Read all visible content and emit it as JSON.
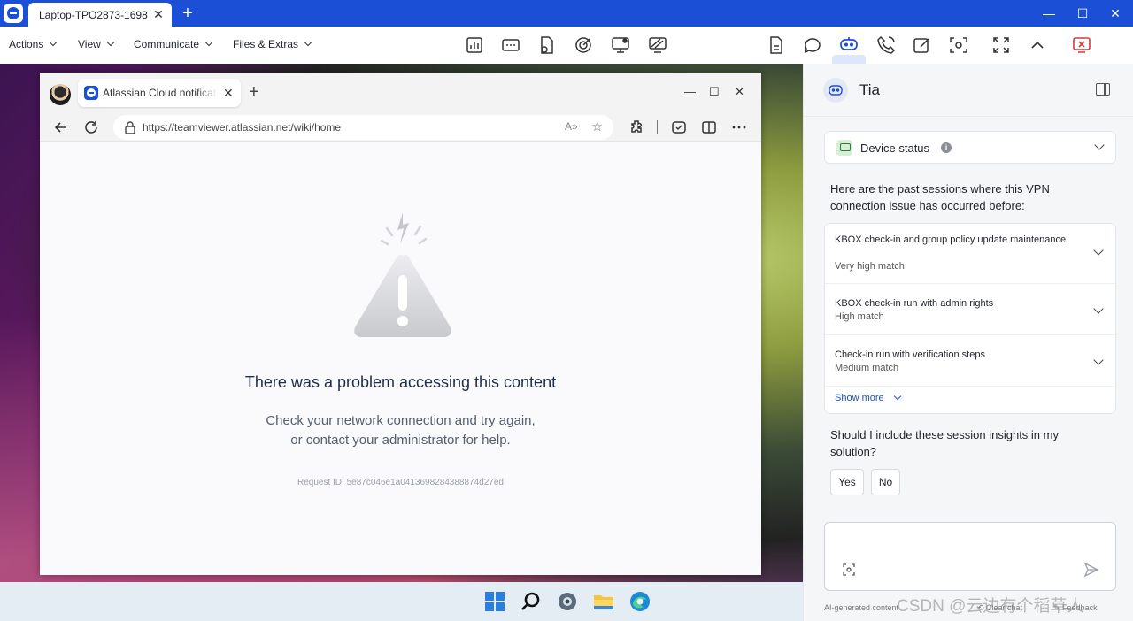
{
  "teamviewer": {
    "tab_title": "Laptop-TPO2873-1698",
    "tab_close": "✕",
    "new_tab": "+",
    "window_controls": {
      "minimize": "—",
      "maximize": "☐",
      "close": "✕"
    },
    "menus": [
      "Actions",
      "View",
      "Communicate",
      "Files & Extras"
    ],
    "toolbar_icons": [
      "dashboard-icon",
      "remote-input-icon",
      "file-transfer-icon",
      "target-icon",
      "screen-record-icon",
      "disable-wallpaper-icon",
      "document-icon",
      "chat-icon",
      "tia-assistant-icon",
      "call-icon",
      "notes-icon",
      "screenshot-icon",
      "fullscreen-icon",
      "collapse-icon",
      "end-session-icon"
    ]
  },
  "browser": {
    "tab_label": "Atlassian Cloud notificat",
    "tab_close": "✕",
    "new_tab": "+",
    "window_controls": {
      "minimize": "—",
      "maximize": "☐",
      "close": "✕"
    },
    "url": "https://teamviewer.atlassian.net/wiki/home",
    "read_aloud": "A»",
    "favorite": "☆",
    "error": {
      "title": "There was a problem accessing this content",
      "line1": "Check your network connection and try again,",
      "line2": "or contact your administrator for help.",
      "request_id": "Request ID: 5e87c046e1a0413698284388874d27ed"
    }
  },
  "taskbar": {
    "icons": [
      "windows-start-icon",
      "search-icon",
      "settings-icon",
      "file-explorer-icon",
      "edge-browser-icon"
    ]
  },
  "tia": {
    "name": "Tia",
    "device_status": "Device status",
    "info": "i",
    "intro": "Here are the past sessions where this VPN connection issue has occurred before:",
    "sessions": [
      {
        "title": "KBOX check-in and group policy update maintenance",
        "match": "Very high match"
      },
      {
        "title": "KBOX check-in run with admin rights",
        "match": "High match"
      },
      {
        "title": "Check-in run with verification steps",
        "match": "Medium match"
      }
    ],
    "show_more": "Show more",
    "question": "Should I include these session insights in my solution?",
    "yes": "Yes",
    "no": "No",
    "chat_placeholder": "",
    "ai_note": "AI-generated content",
    "clear_chat": "Clear chat",
    "feedback": "Feedback"
  },
  "watermark": "CSDN @云边有个稻草人",
  "colors": {
    "accent": "#1a4fd6",
    "panel_bg": "#f5f6f8",
    "error_title": "#1f2e45"
  }
}
